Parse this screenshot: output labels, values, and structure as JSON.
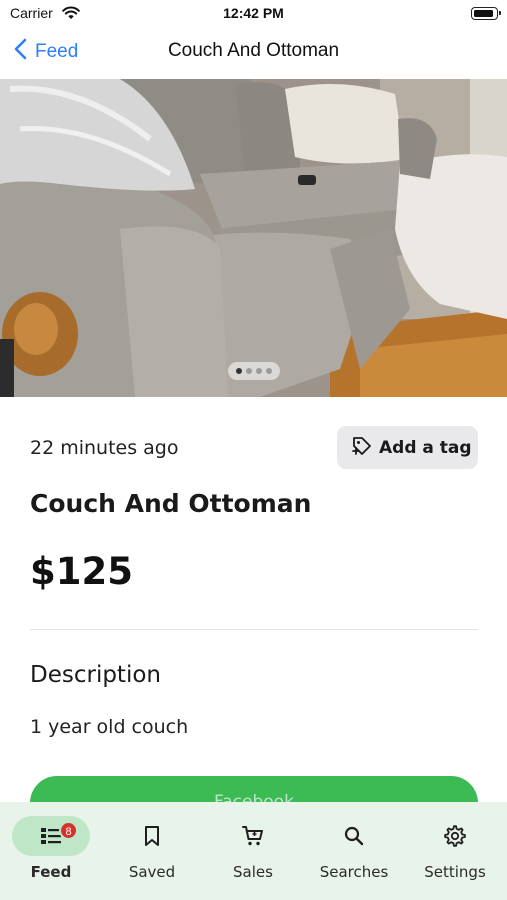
{
  "status_bar": {
    "carrier": "Carrier",
    "time": "12:42 PM"
  },
  "nav": {
    "back_label": "Feed",
    "title": "Couch And Ottoman"
  },
  "photo": {
    "page_count": 4,
    "current_page": 1
  },
  "listing": {
    "time_ago": "22 minutes ago",
    "tag_button_label": "Add a tag",
    "title": "Couch And Ottoman",
    "price": "$125",
    "description_heading": "Description",
    "description": "1 year old couch",
    "action_label": "Facebook"
  },
  "tab_bar": {
    "tabs": [
      {
        "label": "Feed",
        "icon": "feed-list-icon",
        "badge": "8",
        "active": true
      },
      {
        "label": "Saved",
        "icon": "bookmark-icon"
      },
      {
        "label": "Sales",
        "icon": "cart-icon"
      },
      {
        "label": "Searches",
        "icon": "search-icon"
      },
      {
        "label": "Settings",
        "icon": "gear-icon"
      }
    ]
  },
  "colors": {
    "accent_blue": "#2f7ff5",
    "action_green": "#3cba54",
    "tab_bar_bg": "#e8f3ea",
    "active_pill": "#bfe6c6",
    "badge_red": "#d6322c"
  }
}
